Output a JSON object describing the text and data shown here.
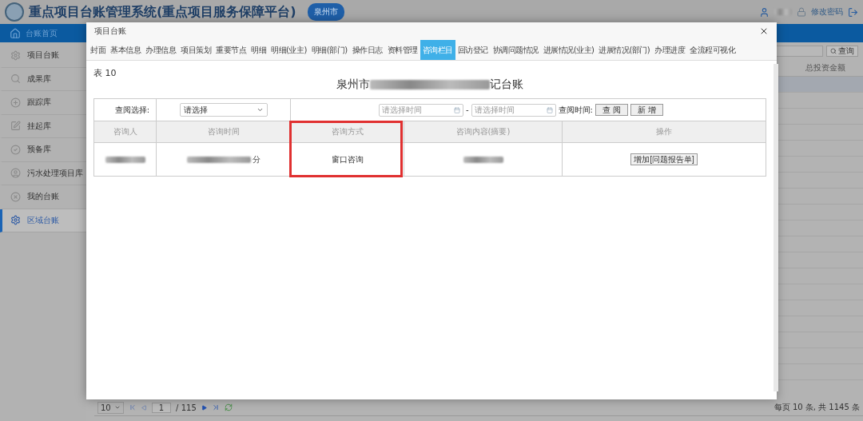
{
  "header": {
    "title": "重点项目台账管理系统(重点项目服务保障平台)",
    "region_badge": "泉州市",
    "actions": [
      "修改密码"
    ]
  },
  "nav": {
    "home": "台账首页"
  },
  "sidebar": {
    "items": [
      {
        "label": "项目台账",
        "selected": false
      },
      {
        "label": "成果库",
        "selected": false
      },
      {
        "label": "跟踪库",
        "selected": false
      },
      {
        "label": "挂起库",
        "selected": false
      },
      {
        "label": "预备库",
        "selected": false
      },
      {
        "label": "污水处理项目库",
        "selected": false
      },
      {
        "label": "我的台账",
        "selected": false
      },
      {
        "label": "区域台账",
        "selected": true
      }
    ]
  },
  "background_table": {
    "search_button": "查询",
    "column_header": "总投资金额"
  },
  "pager": {
    "page_size": "10",
    "page": "1",
    "total_pages": "/ 115",
    "summary": "每页 10 条, 共 1145 条"
  },
  "dialog": {
    "title": "项目台账",
    "tabs": [
      {
        "label": "封面",
        "selected": false
      },
      {
        "label": "基本信息",
        "selected": false
      },
      {
        "label": "办理信息",
        "selected": false
      },
      {
        "label": "项目策划",
        "selected": false
      },
      {
        "label": "重要节点",
        "selected": false
      },
      {
        "label": "明细",
        "selected": false
      },
      {
        "label": "明细(业主)",
        "selected": false
      },
      {
        "label": "明细(部门)",
        "selected": false
      },
      {
        "label": "操作日志",
        "selected": false
      },
      {
        "label": "资料管理",
        "selected": false
      },
      {
        "label": "咨询栏目",
        "selected": true
      },
      {
        "label": "回访登记",
        "selected": false
      },
      {
        "label": "协调问题情况",
        "selected": false
      },
      {
        "label": "进展情况(业主)",
        "selected": false
      },
      {
        "label": "进展情况(部门)",
        "selected": false
      },
      {
        "label": "办理进度",
        "selected": false
      },
      {
        "label": "全流程可视化",
        "selected": false
      }
    ],
    "caption": "表 10",
    "heading_start": "泉州市",
    "heading_end": "记台账",
    "filter": {
      "label": "查阅选择:",
      "select": "请选择",
      "date_from_placeholder": "请选择时间",
      "separator": "-",
      "date_to_placeholder": "请选择时间",
      "time_label": "查阅时间:",
      "buttons": [
        "查 阅",
        "新 增"
      ]
    },
    "columns": [
      {
        "label": "咨询人",
        "highlighted": false
      },
      {
        "label": "咨询时间",
        "highlighted": false
      },
      {
        "label": "咨询方式",
        "highlighted": true
      },
      {
        "label": "咨询内容(摘要)",
        "highlighted": false
      },
      {
        "label": "操作",
        "highlighted": false
      }
    ],
    "rows": [
      {
        "cells": [
          {
            "kind": "redacted"
          },
          {
            "kind": "redacted",
            "suffix": "分"
          },
          {
            "kind": "text",
            "text": "窗口咨询"
          },
          {
            "kind": "redacted"
          },
          {
            "kind": "button",
            "text": "增加[问题报告单]"
          }
        ]
      }
    ]
  }
}
